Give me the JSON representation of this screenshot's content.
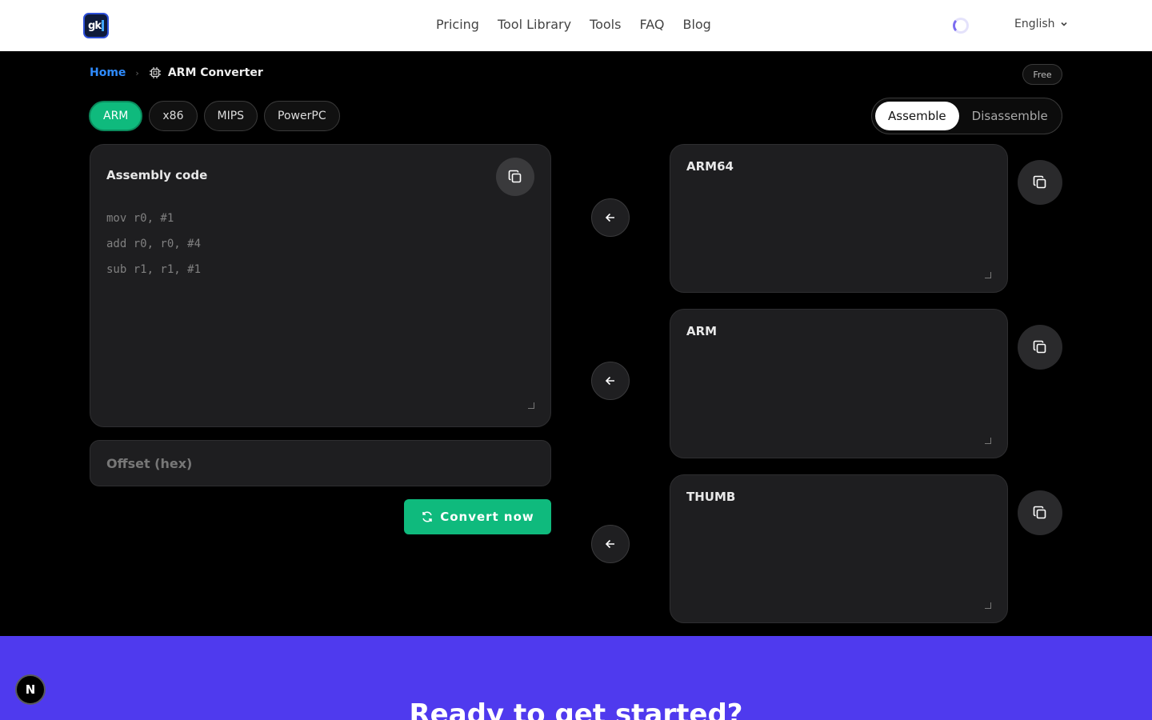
{
  "header": {
    "logo_text": "gk",
    "nav": [
      "Pricing",
      "Tool Library",
      "Tools",
      "FAQ",
      "Blog"
    ],
    "language": "English"
  },
  "breadcrumb": {
    "home": "Home",
    "separator": "›",
    "current": "ARM Converter"
  },
  "badge": "Free",
  "arch_tabs": [
    "ARM",
    "x86",
    "MIPS",
    "PowerPC"
  ],
  "arch_active": "ARM",
  "mode": {
    "assemble": "Assemble",
    "disassemble": "Disassemble",
    "active": "Assemble"
  },
  "input": {
    "label": "Assembly code",
    "placeholder_lines": [
      "mov r0, #1",
      "add r0, r0, #4",
      "sub r1, r1, #1"
    ],
    "offset_placeholder": "Offset (hex)"
  },
  "convert_label": "Convert now",
  "outputs": [
    {
      "label": "ARM64",
      "value": ""
    },
    {
      "label": "ARM",
      "value": ""
    },
    {
      "label": "THUMB",
      "value": ""
    }
  ],
  "cta": {
    "title": "Ready to get started?"
  },
  "floating_badge": "N",
  "colors": {
    "accent_green": "#0fba7d",
    "link_blue": "#2f8cff",
    "cta_purple": "#4f3aee"
  },
  "icons": [
    "chip-icon",
    "copy-icon",
    "arrow-left-icon",
    "refresh-icon",
    "chevron-down-icon",
    "spinner-icon"
  ]
}
